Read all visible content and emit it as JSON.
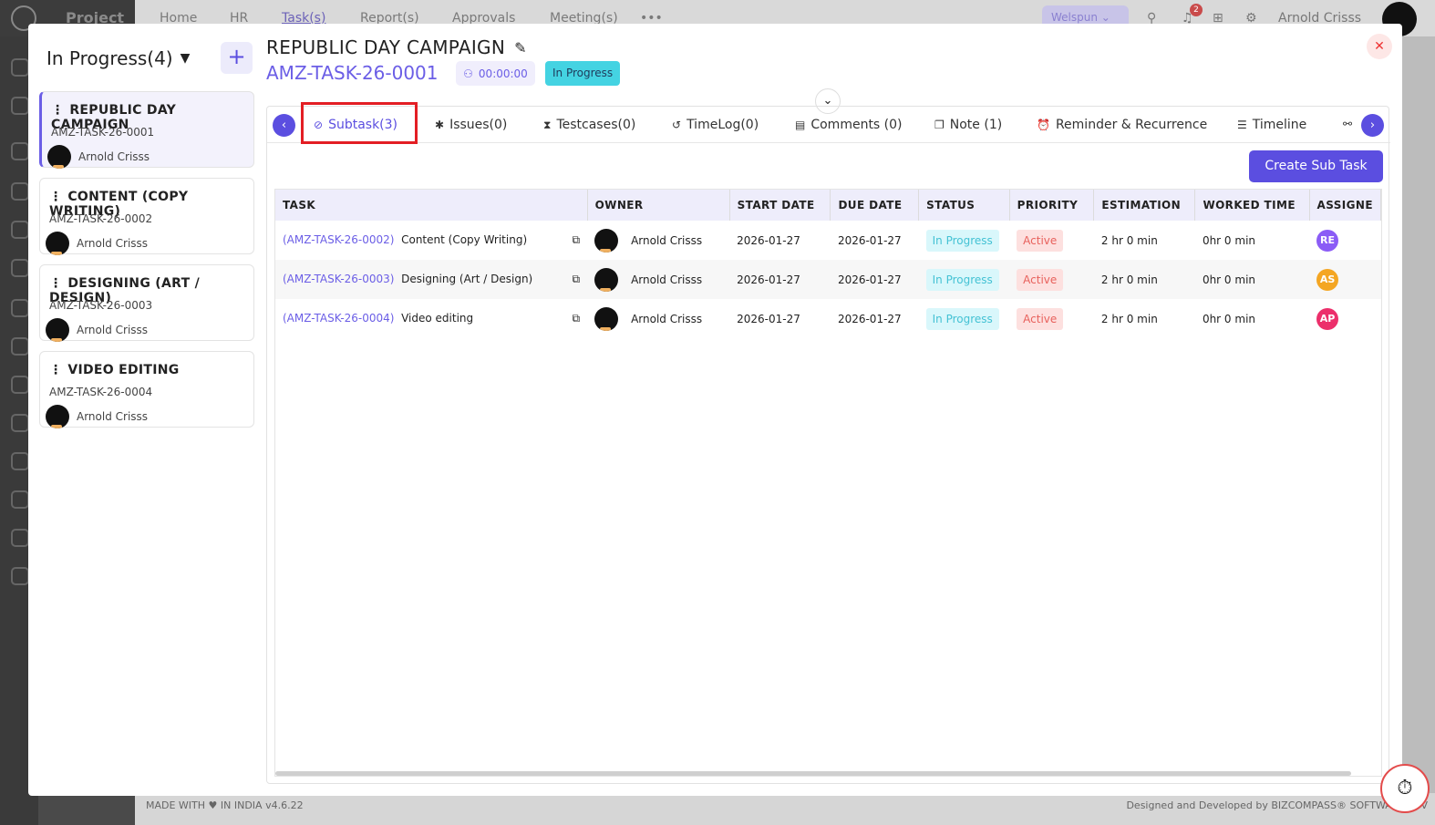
{
  "background": {
    "brand": "Project",
    "nav": [
      "Home",
      "HR",
      "Task(s)",
      "Report(s)",
      "Approvals",
      "Meeting(s)",
      "•••"
    ],
    "company": "Welspun",
    "notification_count": "2",
    "user_name": "Arnold Crisss",
    "footer_left": "MADE WITH ♥ IN INDIA v4.6.22",
    "footer_right": "Designed and Developed by BIZCOMPASS® SOFTWARES PV"
  },
  "left_panel": {
    "header": "In Progress(4)",
    "add_label": "+",
    "cards": [
      {
        "title": "REPUBLIC DAY CAMPAIGN",
        "code": "AMZ-TASK-26-0001",
        "owner": "Arnold Crisss"
      },
      {
        "title": "CONTENT (COPY WRITING)",
        "code": "AMZ-TASK-26-0002",
        "owner": "Arnold Crisss"
      },
      {
        "title": "DESIGNING (ART / DESIGN)",
        "code": "AMZ-TASK-26-0003",
        "owner": "Arnold Crisss"
      },
      {
        "title": "VIDEO EDITING",
        "code": "AMZ-TASK-26-0004",
        "owner": "Arnold Crisss"
      }
    ]
  },
  "task": {
    "title": "REPUBLIC DAY CAMPAIGN",
    "code": "AMZ-TASK-26-0001",
    "timer": "00:00:00",
    "status": "In Progress"
  },
  "tabs": [
    {
      "label": "Subtask(3)",
      "icon": "check-circle-icon"
    },
    {
      "label": "Issues(0)",
      "icon": "bug-icon"
    },
    {
      "label": "Testcases(0)",
      "icon": "hourglass-icon"
    },
    {
      "label": "TimeLog(0)",
      "icon": "history-icon"
    },
    {
      "label": "Comments (0)",
      "icon": "comment-icon"
    },
    {
      "label": "Note (1)",
      "icon": "note-icon"
    },
    {
      "label": "Reminder & Recurrence",
      "icon": "alarm-icon"
    },
    {
      "label": "Timeline",
      "icon": "timeline-icon"
    }
  ],
  "create_button": "Create Sub Task",
  "table": {
    "headers": [
      "TASK",
      "OWNER",
      "START DATE",
      "DUE DATE",
      "STATUS",
      "PRIORITY",
      "ESTIMATION",
      "WORKED TIME",
      "ASSIGNE"
    ],
    "rows": [
      {
        "code": "(AMZ-TASK-26-0002)",
        "name": "Content (Copy Writing)",
        "owner": "Arnold Crisss",
        "start": "2026-01-27",
        "due": "2026-01-27",
        "status": "In Progress",
        "priority": "Active",
        "estimation": "2 hr 0 min",
        "worked": "0hr 0 min",
        "assignee": "RE",
        "assignee_color": "#8b5cf6"
      },
      {
        "code": "(AMZ-TASK-26-0003)",
        "name": "Designing (Art / Design)",
        "owner": "Arnold Crisss",
        "start": "2026-01-27",
        "due": "2026-01-27",
        "status": "In Progress",
        "priority": "Active",
        "estimation": "2 hr 0 min",
        "worked": "0hr 0 min",
        "assignee": "AS",
        "assignee_color": "#f4a623"
      },
      {
        "code": "(AMZ-TASK-26-0004)",
        "name": "Video editing",
        "owner": "Arnold Crisss",
        "start": "2026-01-27",
        "due": "2026-01-27",
        "status": "In Progress",
        "priority": "Active",
        "estimation": "2 hr 0 min",
        "worked": "0hr 0 min",
        "assignee": "AP",
        "assignee_color": "#ec2f6b"
      }
    ]
  }
}
